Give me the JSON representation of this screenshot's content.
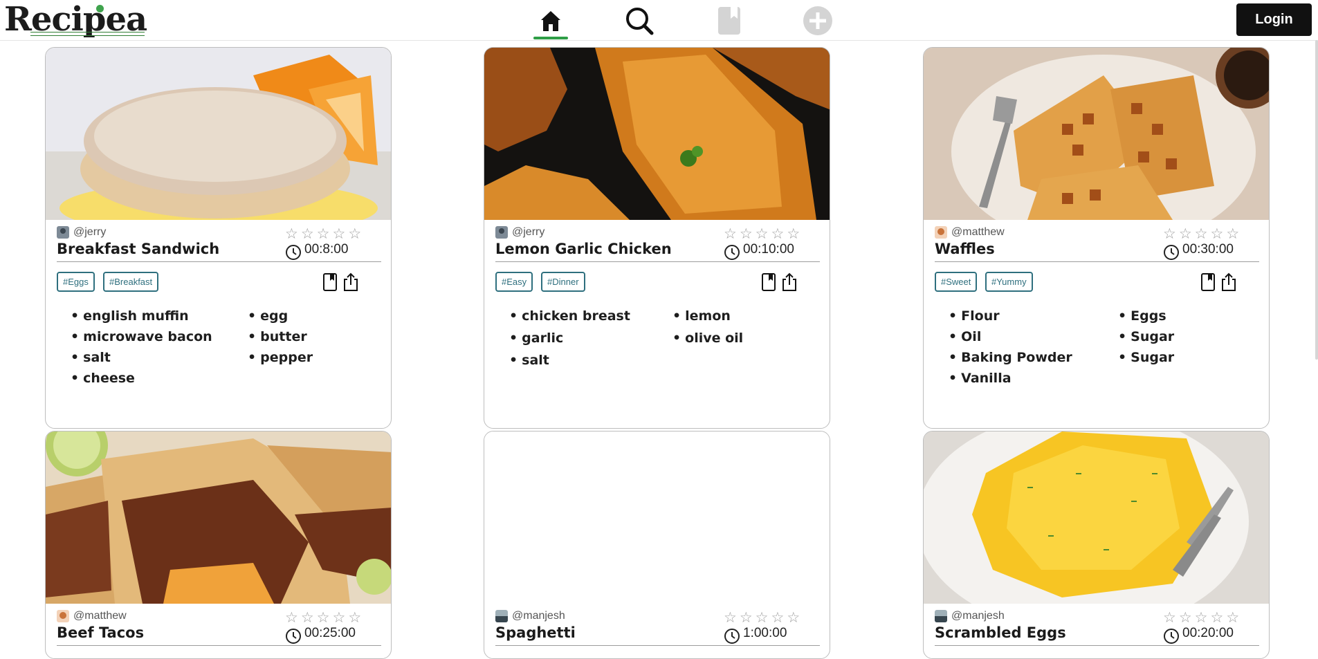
{
  "app": {
    "logo_text": "Recipea"
  },
  "nav": {
    "items": [
      {
        "name": "home",
        "icon": "home-icon",
        "active": true
      },
      {
        "name": "search",
        "icon": "search-icon",
        "active": false
      },
      {
        "name": "saved",
        "icon": "bookmark-icon",
        "active": false
      },
      {
        "name": "create",
        "icon": "plus-circle-icon",
        "active": false
      }
    ],
    "login_label": "Login"
  },
  "colors": {
    "accent": "#2e9e46",
    "tag": "#2e6f7e",
    "star": "#9e9e9e"
  },
  "recipes": [
    {
      "author": "@jerry",
      "title": "Breakfast Sandwich",
      "time": "00:8:00",
      "rating": 0,
      "tags": [
        "#Eggs",
        "#Breakfast"
      ],
      "ingredients_left": [
        "english muffin",
        "microwave bacon",
        "salt",
        "cheese"
      ],
      "ingredients_right": [
        "egg",
        "butter",
        "pepper"
      ]
    },
    {
      "author": "@jerry",
      "title": "Lemon Garlic Chicken",
      "time": "00:10:00",
      "rating": 0,
      "tags": [
        "#Easy",
        "#Dinner"
      ],
      "ingredients_left": [
        "chicken breast",
        "garlic",
        "salt"
      ],
      "ingredients_right": [
        "lemon",
        "olive oil"
      ]
    },
    {
      "author": "@matthew",
      "title": "Waffles",
      "time": "00:30:00",
      "rating": 0,
      "tags": [
        "#Sweet",
        "#Yummy"
      ],
      "ingredients_left": [
        "Flour",
        "Oil",
        "Baking Powder",
        "Vanilla"
      ],
      "ingredients_right": [
        "Eggs",
        "Sugar",
        "Sugar"
      ]
    },
    {
      "author": "@matthew",
      "title": "Beef Tacos",
      "time": "00:25:00",
      "rating": 0
    },
    {
      "author": "@manjesh",
      "title": "Spaghetti",
      "time": "1:00:00",
      "rating": 0
    },
    {
      "author": "@manjesh",
      "title": "Scrambled Eggs",
      "time": "00:20:00",
      "rating": 0
    }
  ]
}
